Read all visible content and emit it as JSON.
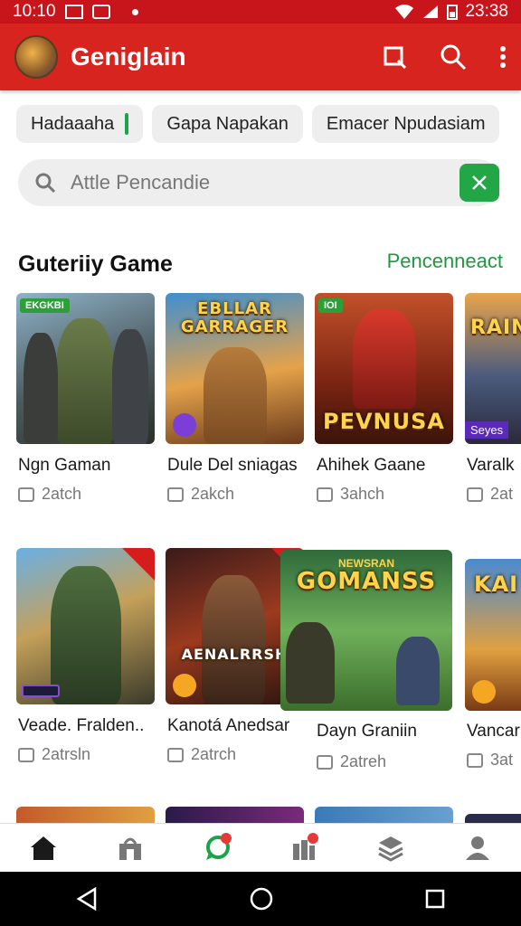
{
  "status_bar": {
    "time": "10:10",
    "right_time": "23:38"
  },
  "app_bar": {
    "title": "Geniglain"
  },
  "chips": [
    {
      "label": "Hadaaaha"
    },
    {
      "label": "Gapa Napakan"
    },
    {
      "label": "Emacer Npudasiam"
    }
  ],
  "search": {
    "placeholder": "Attle Pencandie"
  },
  "section": {
    "title": "Guteriiy Game",
    "link": "Pencenneact"
  },
  "row1": [
    {
      "title": "Ngn Gaman",
      "meta": "2atch",
      "art_text": "",
      "tag": "EKGKBI"
    },
    {
      "title": "Dule Del sniagas",
      "meta": "2akch",
      "art_text": "EBLLAR GARRAGER",
      "tag": ""
    },
    {
      "title": "Ahihek Gaane",
      "meta": "3ahch",
      "art_text": "PEVNUSA",
      "tag": "IOI"
    },
    {
      "title": "Varalk",
      "meta": "2at",
      "art_text": "RAIN",
      "tag": "Seyes"
    }
  ],
  "row2": [
    {
      "title": "Veade. Fralden..",
      "meta": "2atrsln",
      "art_text": "",
      "tag": ""
    },
    {
      "title": "Kanotá Anedsar",
      "meta": "2atrch",
      "art_text": "AENALRRSH",
      "tag": ""
    },
    {
      "title": "Dayn Graniin",
      "meta": "2atreh",
      "art_text": "GOMANSS",
      "tag": "NEWSRAN"
    },
    {
      "title": "Vancar",
      "meta": "3at",
      "art_text": "KAI",
      "tag": ""
    }
  ],
  "colors": {
    "brand": "#d8241f",
    "accent": "#1e9a3e"
  },
  "nav_icons": [
    "home-icon",
    "store-icon",
    "chat-icon",
    "library-icon",
    "layers-icon",
    "profile-icon"
  ]
}
